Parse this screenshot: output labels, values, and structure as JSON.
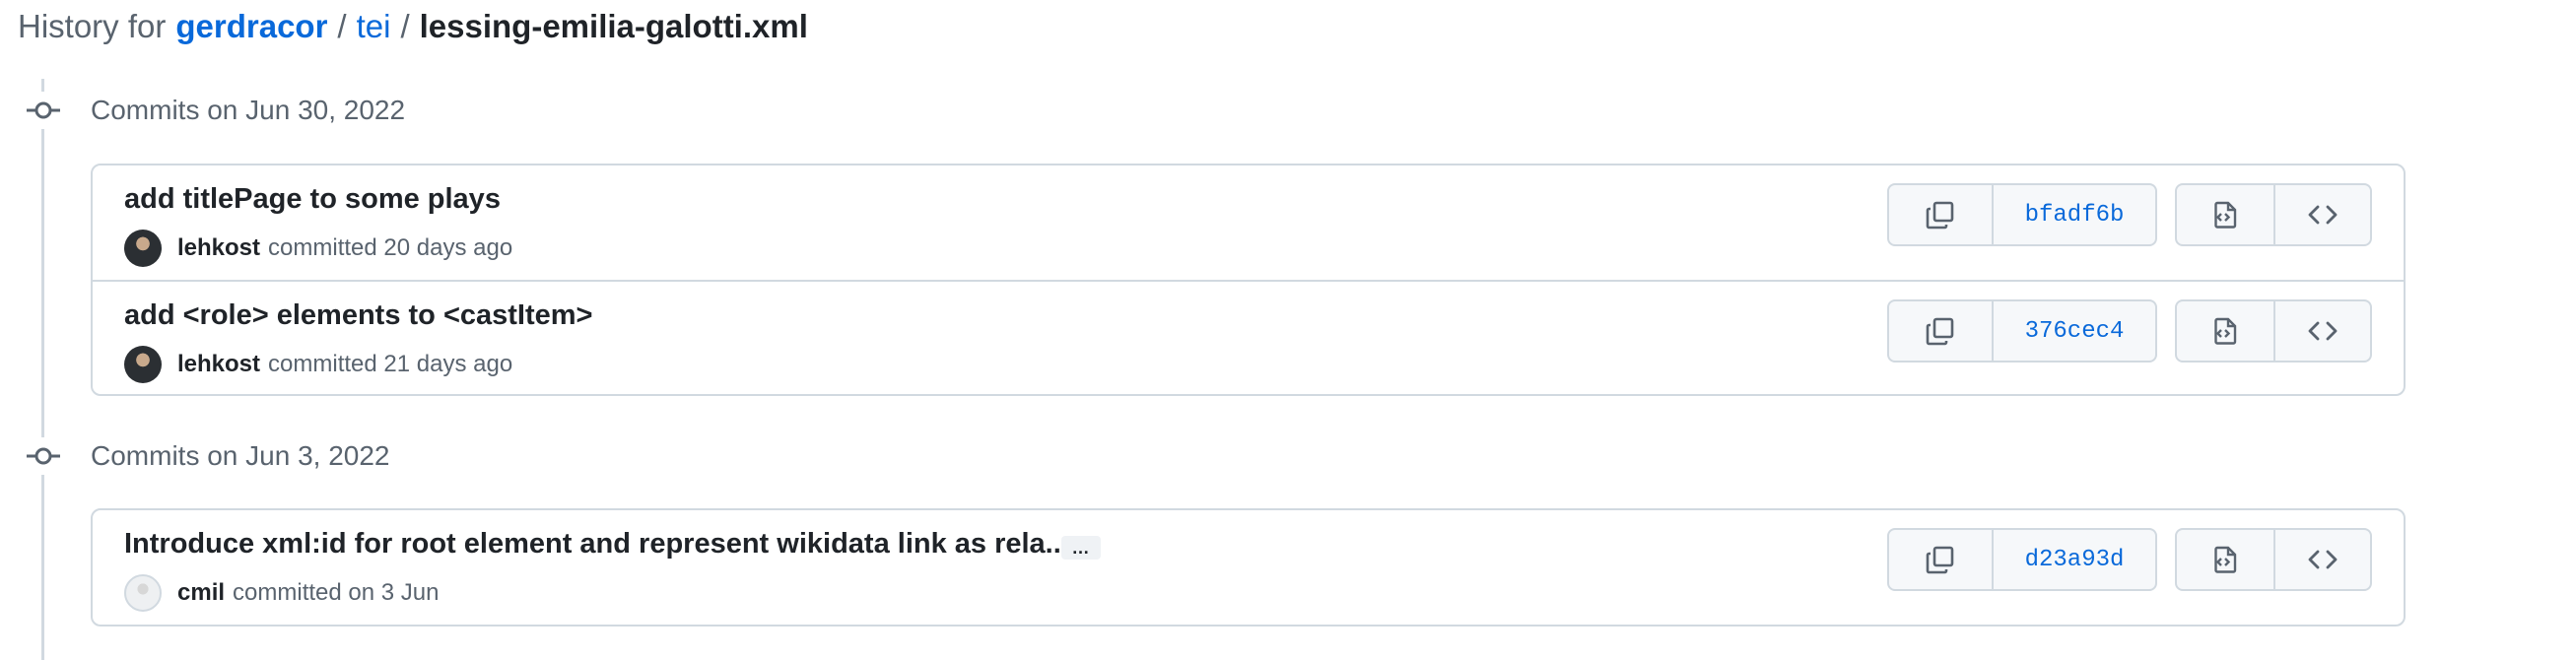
{
  "breadcrumb": {
    "prefix": "History for",
    "owner": "gerdracor",
    "separator": "/",
    "repo": "tei",
    "file": "lessing-emilia-galotti.xml"
  },
  "groups": [
    {
      "title": "Commits on Jun 30, 2022",
      "commits": [
        {
          "title": "add titlePage to some plays",
          "author": "lehkost",
          "committed": "committed 20 days ago",
          "sha": "bfadf6b",
          "avatar": "dark"
        },
        {
          "title": "add <role> elements to <castItem>",
          "author": "lehkost",
          "committed": "committed 21 days ago",
          "sha": "376cec4",
          "avatar": "dark"
        }
      ]
    },
    {
      "title": "Commits on Jun 3, 2022",
      "commits": [
        {
          "title": "Introduce xml:id for root element and represent wikidata link as rela...",
          "ellipsis": "…",
          "author": "cmil",
          "committed": "committed on 3 Jun",
          "sha": "d23a93d",
          "avatar": "light"
        }
      ]
    }
  ],
  "icons": {
    "copy": "copy-icon",
    "file": "file-code-icon",
    "code": "code-icon",
    "commit": "git-commit-icon"
  },
  "colors": {
    "link": "#0969da",
    "text": "#1f2328",
    "muted": "#59636e",
    "border": "#d1d9e0",
    "button_bg": "#f6f8fa"
  }
}
